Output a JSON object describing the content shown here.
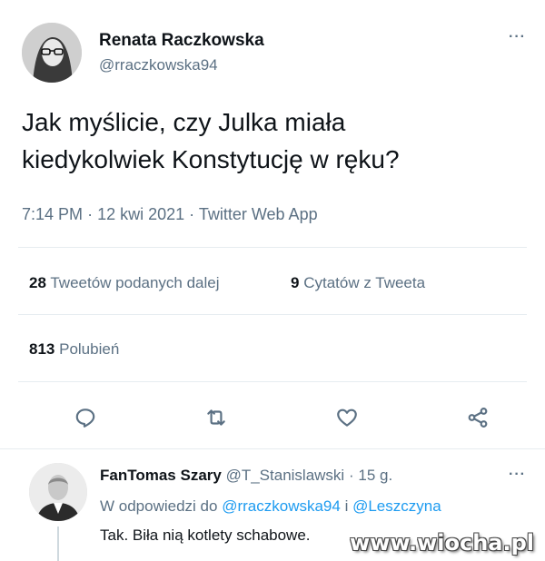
{
  "tweet": {
    "author_name": "Renata Raczkowska",
    "author_handle": "@rraczkowska94",
    "text_line1": "Jak myślicie, czy Julka miała",
    "text_line2": "kiedykolwiek Konstytucję w ręku?",
    "time": "7:14 PM",
    "date": "12 kwi 2021",
    "source": "Twitter Web App",
    "sep": "·",
    "more": "···",
    "retweets_count": "28",
    "retweets_label": "Tweetów podanych dalej",
    "quotes_count": "9",
    "quotes_label": "Cytatów z Tweeta",
    "likes_count": "813",
    "likes_label": "Polubień"
  },
  "actions": [
    "reply-icon",
    "retweet-icon",
    "like-icon",
    "share-icon"
  ],
  "reply": {
    "author_name": "FanTomas Szary",
    "author_handle": "@T_Stanislawski",
    "sep": "·",
    "age": "15 g.",
    "more": "···",
    "in_reply_prefix": "W odpowiedzi do",
    "mention1": "@rraczkowska94",
    "conj": "i",
    "mention2": "@Leszczyna",
    "text": "Tak. Biła nią kotlety schabowe."
  },
  "watermark": "www.wiocha.pl",
  "colors": {
    "text": "#0f1419",
    "muted": "#5b7083",
    "link": "#1d9bf0",
    "divider": "#e6ecf0"
  }
}
